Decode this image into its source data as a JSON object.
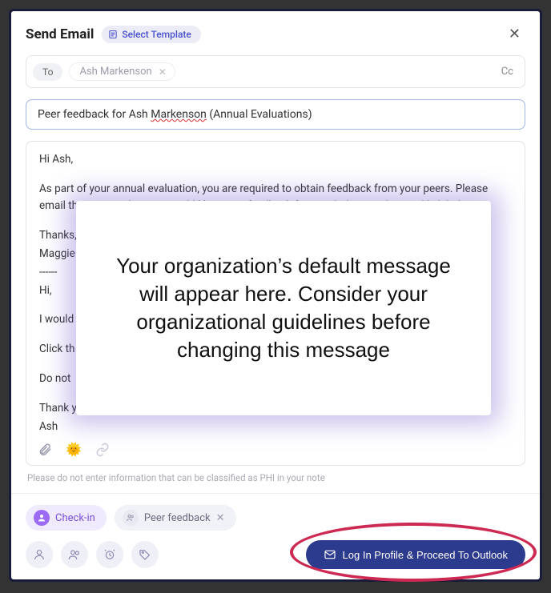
{
  "header": {
    "title": "Send Email",
    "select_template": "Select Template"
  },
  "to": {
    "label": "To",
    "recipient": "Ash Markenson",
    "cc": "Cc"
  },
  "subject": {
    "pre": "Peer feedback for Ash ",
    "mid": "Markenson",
    "post": " (Annual Evaluations)"
  },
  "body": {
    "greeting": "Hi Ash,",
    "p1": "As part of your annual evaluation, you are required to obtain feedback from your peers. Please email three peers that you would like to get feedback from with the template and link below.",
    "thanks": "Thanks,",
    "signer": "Maggie",
    "sep": "------",
    "hi2": "Hi,",
    "l1": "I would",
    "l2": "Click th",
    "l3": "Do not",
    "close1": "Thank y",
    "close2": "Ash"
  },
  "overlay": "Your organization’s default message will appear here. Consider your organizational guidelines before changing this message",
  "phi_note": "Please do not enter information that can be classified as PHI in your note",
  "tags": {
    "checkin": "Check-in",
    "peer": "Peer feedback"
  },
  "footer": {
    "proceed": "Log In Profile & Proceed To Outlook"
  }
}
